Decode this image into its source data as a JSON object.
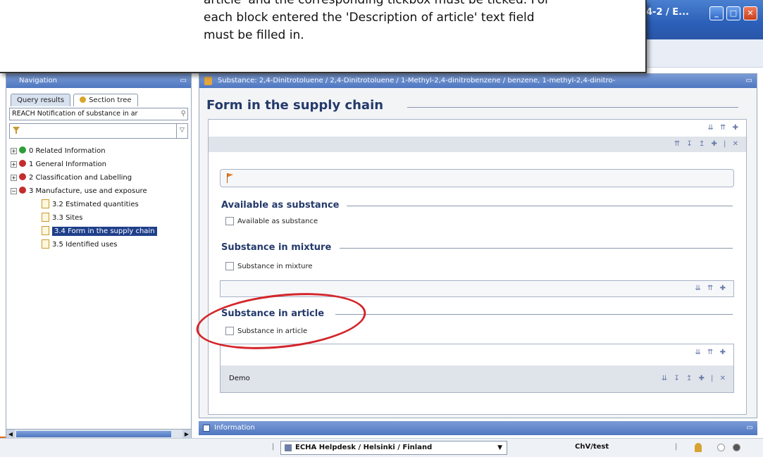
{
  "window": {
    "title_fragment": "4-2 / E...",
    "controls": {
      "minimize": "_",
      "maximize": "□",
      "close": "✕"
    }
  },
  "callout": {
    "text": "article' and the corresponding tickbox must be ticked. For\neach block entered the 'Description of article' text field\nmust be filled in."
  },
  "navigation": {
    "header": "Navigation",
    "tabs": [
      {
        "label": "Query results"
      },
      {
        "label": "Section tree"
      }
    ],
    "search_value": "REACH Notification of substance in ar",
    "tree": [
      {
        "toggle": "+",
        "label": "0 Related Information"
      },
      {
        "toggle": "+",
        "label": "1 General Information"
      },
      {
        "toggle": "+",
        "label": "2 Classification and Labelling"
      },
      {
        "toggle": "−",
        "label": "3 Manufacture, use and exposure"
      }
    ],
    "children": [
      {
        "label": "3.2 Estimated quantities"
      },
      {
        "label": "3.3 Sites"
      },
      {
        "label": "3.4 Form in the supply chain"
      },
      {
        "label": "3.5 Identified uses"
      }
    ]
  },
  "main": {
    "header": "Substance: 2,4-Dinitrotoluene / 2,4-Dinitrotoluene / 1-Methyl-2,4-dinitrobenzene / benzene, 1-methyl-2,4-dinitro-",
    "title": "Form in the supply chain",
    "available": {
      "heading": "Available as substance",
      "checkbox_label": "Available as substance"
    },
    "mixture": {
      "heading": "Substance in mixture",
      "checkbox_label": "Substance in mixture"
    },
    "article": {
      "heading": "Substance in article",
      "checkbox_label": "Substance in article",
      "block_label": "Demo"
    }
  },
  "information": {
    "header": "Information"
  },
  "statusbar": {
    "organisation": "ECHA Helpdesk / Helsinki / Finland",
    "user": "ChV/test"
  },
  "colors": {
    "accent": "#2b5fb8",
    "highlight_ellipse": "#d3262b",
    "heading": "#243a6b"
  }
}
